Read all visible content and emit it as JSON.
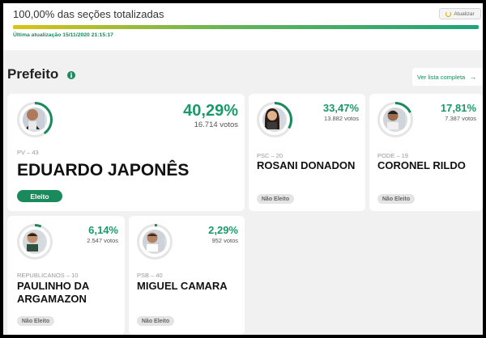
{
  "status": {
    "title": "100,00% das seções totalizadas",
    "refresh_label": "Atualizar",
    "progress_pct": 100,
    "updated_label": "Última atualização 15/11/2020 21:15:17"
  },
  "section": {
    "title": "Prefeito",
    "info_icon": "info-icon",
    "full_list_label": "Ver lista completa",
    "full_list_arrow": "→"
  },
  "colors": {
    "accent": "#1a8a5c",
    "percent": "#1a9a6a"
  },
  "candidates": [
    {
      "party": "PV – 43",
      "name": "EDUARDO JAPONÊS",
      "pct": "40,29%",
      "votes": "16.714 votos",
      "status": "Eleito",
      "pct_value": 40.29
    },
    {
      "party": "PSC – 20",
      "name": "ROSANI DONADON",
      "pct": "33,47%",
      "votes": "13.882 votos",
      "status": "Não Eleito",
      "pct_value": 33.47
    },
    {
      "party": "PODE – 19",
      "name": "CORONEL RILDO",
      "pct": "17,81%",
      "votes": "7.387 votos",
      "status": "Não Eleito",
      "pct_value": 17.81
    },
    {
      "party": "REPUBLICANOS – 10",
      "name": "PAULINHO DA ARGAMAZON",
      "pct": "6,14%",
      "votes": "2.547 votos",
      "status": "Não Eleito",
      "pct_value": 6.14
    },
    {
      "party": "PSB – 40",
      "name": "MIGUEL CAMARA",
      "pct": "2,29%",
      "votes": "952 votos",
      "status": "Não Eleito",
      "pct_value": 2.29
    }
  ]
}
